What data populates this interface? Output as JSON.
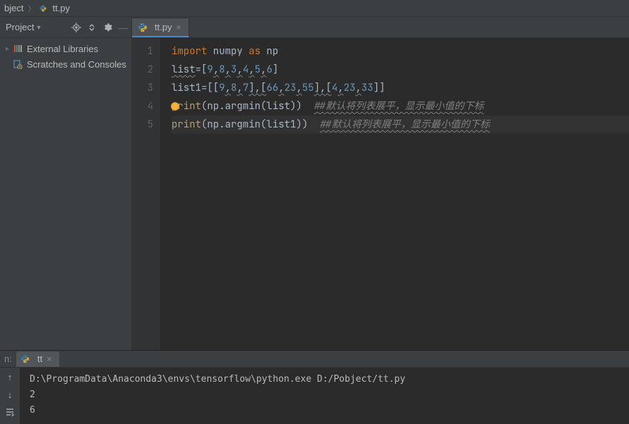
{
  "breadcrumb": {
    "root": "bject",
    "file": "tt.py"
  },
  "sidebar": {
    "title": "Project",
    "items": [
      {
        "label": "External Libraries"
      },
      {
        "label": "Scratches and Consoles"
      }
    ]
  },
  "tabs": [
    {
      "label": "tt.py"
    }
  ],
  "code": {
    "lines": {
      "l1_import": "import",
      "l1_numpy": " numpy ",
      "l1_as": "as",
      "l1_np": " np",
      "l2_list": "list",
      "l2_eq": "=[",
      "l2_n0": "9",
      "l2_c0": ",",
      "l2_n1": "8",
      "l2_c1": ",",
      "l2_n2": "3",
      "l2_c2": ",",
      "l2_n3": "4",
      "l2_c3": ",",
      "l2_n4": "5",
      "l2_c4": ",",
      "l2_n5": "6",
      "l2_close": "]",
      "l3_list1": "list1",
      "l3_eq": "=[[",
      "l3_n0": "9",
      "l3_c0": ",",
      "l3_n1": "8",
      "l3_c1": ",",
      "l3_n2": "7",
      "l3_b1": "],[",
      "l3_n3": "66",
      "l3_c3": ",",
      "l3_n4": "23",
      "l3_c4": ",",
      "l3_n5": "55",
      "l3_b2": "],[",
      "l3_n6": "4",
      "l3_c6": ",",
      "l3_n7": "23",
      "l3_c7": ",",
      "l3_n8": "33",
      "l3_close": "]]",
      "l4_print": "print",
      "l4_open": "(np.",
      "l4_argmin": "argmin",
      "l4_args": "(list))  ",
      "l4_comment": "##默认将列表展平，显示最小值的下标",
      "l5_print": "print",
      "l5_open": "(np.",
      "l5_argmin": "argmin",
      "l5_args": "(list1))  ",
      "l5_comment": "##默认将列表展平，显示最小值的下标"
    },
    "gutter": [
      "1",
      "2",
      "3",
      "4",
      "5"
    ]
  },
  "run": {
    "label": "n:",
    "tab": "tt",
    "out": [
      "D:\\ProgramData\\Anaconda3\\envs\\tensorflow\\python.exe D:/Pobject/tt.py",
      "2",
      "6"
    ]
  }
}
